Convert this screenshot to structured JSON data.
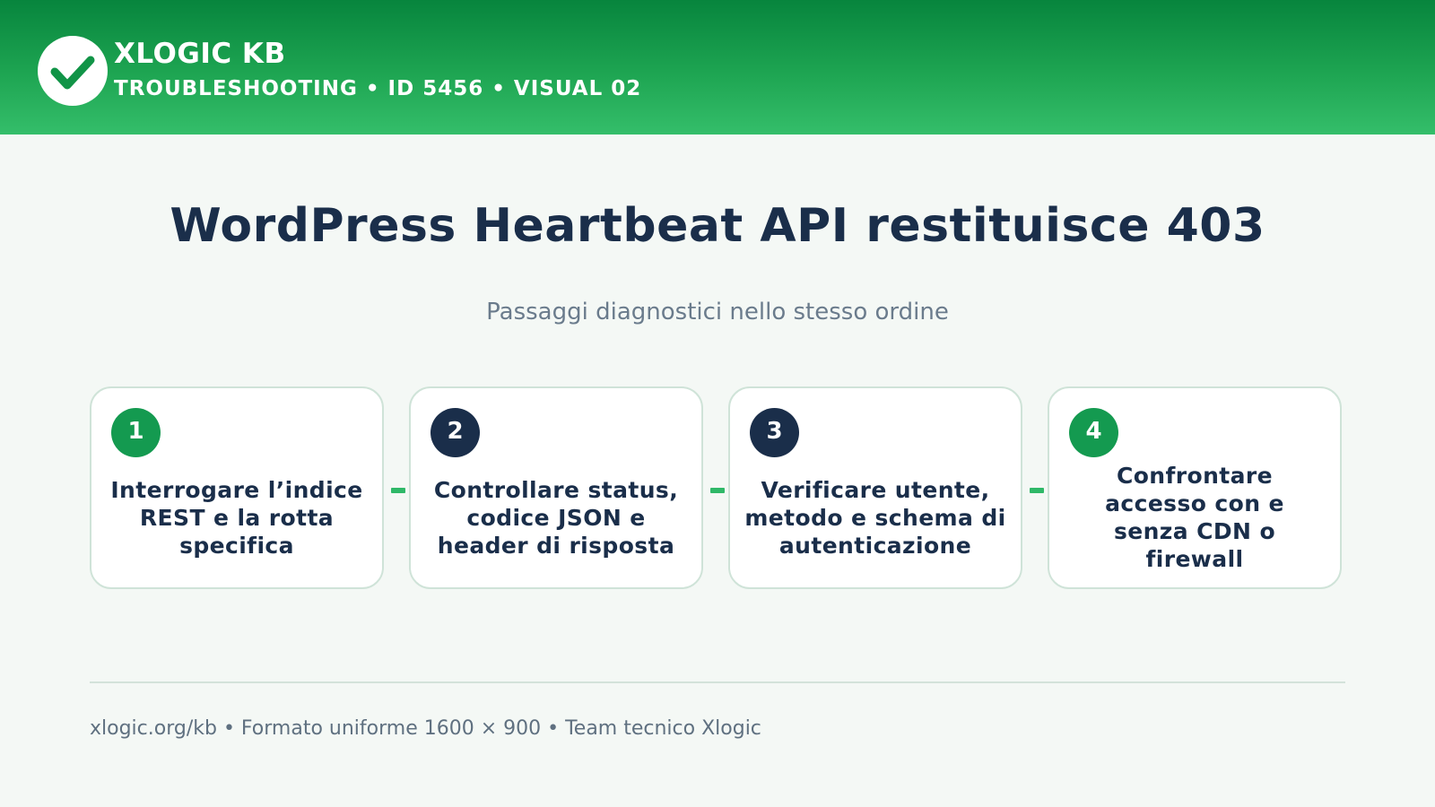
{
  "header": {
    "brand": "XLOGIC KB",
    "subbrand": "TROUBLESHOOTING • ID 5456 • VISUAL 02",
    "logo_icon": "checkmark-icon",
    "colors": {
      "band_top": "#07853d",
      "band_bottom": "#34be6a"
    }
  },
  "main": {
    "title": "WordPress Heartbeat API restituisce 403",
    "subtitle": "Passaggi diagnostici nello stesso ordine"
  },
  "steps": [
    {
      "number": "1",
      "text": "Interrogare l’indice REST e la rotta specifica",
      "badge_color": "#149a50"
    },
    {
      "number": "2",
      "text": "Controllare status, codice JSON e header di risposta",
      "badge_color": "#1a2e4a"
    },
    {
      "number": "3",
      "text": "Verificare utente, metodo e schema di autenticazione",
      "badge_color": "#1a2e4a"
    },
    {
      "number": "4",
      "text": "Confrontare accesso con e senza CDN o firewall",
      "badge_color": "#149a50"
    }
  ],
  "footer": {
    "text": "xlogic.org/kb • Formato uniforme 1600 × 900 • Team tecnico Xlogic"
  }
}
